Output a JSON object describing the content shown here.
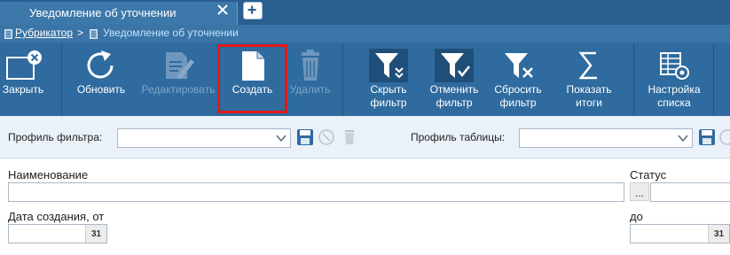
{
  "tab": {
    "title": "Уведомление об уточнении"
  },
  "breadcrumb": {
    "root": "Рубрикатор",
    "separator": ">",
    "current": "Уведомление об уточнении"
  },
  "toolbar": {
    "close": "Закрыть",
    "refresh": "Обновить",
    "edit": "Редактировать",
    "create": "Создать",
    "delete": "Удалить",
    "hide_filter": [
      "Скрыть",
      "фильтр"
    ],
    "cancel_filter": [
      "Отменить",
      "фильтр"
    ],
    "reset_filter": [
      "Сбросить",
      "фильтр"
    ],
    "show_totals": [
      "Показать",
      "итоги"
    ],
    "list_settings": [
      "Настройка",
      "списка"
    ]
  },
  "filter": {
    "profile_label": "Профиль фильтра:",
    "profile_value": "",
    "table_profile_label": "Профиль таблицы:",
    "table_profile_value": ""
  },
  "form": {
    "name_label": "Наименование",
    "name_value": "",
    "status_label": "Статус",
    "status_value": "",
    "status_button": "...",
    "created_from_label": "Дата создания, от",
    "created_from_value": "",
    "to_label": "до",
    "to_value": "",
    "calendar_glyph": "31"
  },
  "colors": {
    "tabstrip": "#2a5f90",
    "toolbar": "#2f6b9f",
    "highlight": "#e01919",
    "filterbar": "#eaf1f8"
  }
}
